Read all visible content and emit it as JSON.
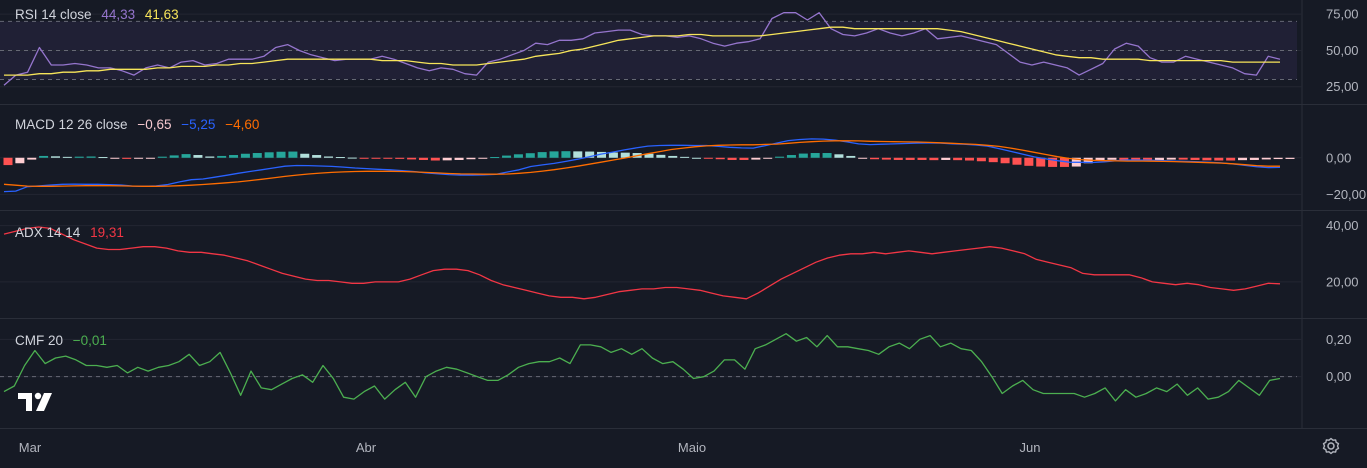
{
  "chart_data": [
    {
      "type": "line",
      "name": "RSI",
      "legend": {
        "title": "RSI 14 close",
        "values": [
          {
            "text": "44,33",
            "color": "#9575cd"
          },
          {
            "text": "41,63",
            "color": "#f7e55a"
          }
        ]
      },
      "ylim": [
        20,
        82
      ],
      "band": [
        30,
        70
      ],
      "ticks": [
        {
          "v": 75,
          "label": "75,00"
        },
        {
          "v": 50,
          "label": "50,00"
        },
        {
          "v": 25,
          "label": "25,00"
        }
      ],
      "dashed": [
        70,
        50,
        30
      ],
      "series": [
        {
          "color": "#9575cd",
          "values": [
            26,
            33,
            35,
            52,
            40,
            40,
            41,
            40,
            38,
            38,
            36,
            33,
            38,
            40,
            38,
            42,
            43,
            40,
            41,
            44,
            44,
            44,
            46,
            52,
            54,
            50,
            47,
            45,
            43,
            44,
            44,
            44,
            46,
            44,
            41,
            38,
            36,
            38,
            37,
            34,
            33,
            42,
            44,
            47,
            50,
            55,
            54,
            57,
            57,
            58,
            62,
            63,
            64,
            64,
            61,
            60,
            60,
            59,
            60,
            58,
            55,
            53,
            55,
            56,
            58,
            72,
            76,
            76,
            71,
            76,
            65,
            61,
            60,
            62,
            65,
            62,
            60,
            62,
            65,
            58,
            59,
            60,
            58,
            56,
            54,
            48,
            42,
            40,
            42,
            40,
            38,
            33,
            37,
            41,
            51,
            55,
            53,
            45,
            42,
            42,
            46,
            44,
            42,
            40,
            38,
            34,
            33,
            46,
            44
          ]
        },
        {
          "color": "#f7e55a",
          "values": [
            33,
            33,
            33,
            34,
            34,
            35,
            35,
            36,
            36,
            37,
            37,
            37,
            37,
            38,
            38,
            39,
            39,
            39,
            40,
            40,
            41,
            41,
            42,
            43,
            44,
            44,
            44,
            44,
            44,
            44,
            44,
            44,
            43,
            43,
            43,
            42,
            41,
            41,
            40,
            40,
            40,
            41,
            42,
            43,
            44,
            46,
            47,
            48,
            50,
            51,
            53,
            55,
            57,
            58,
            59,
            60,
            60,
            60,
            61,
            61,
            60,
            60,
            60,
            60,
            60,
            61,
            62,
            63,
            64,
            65,
            66,
            66,
            65,
            65,
            65,
            65,
            65,
            65,
            65,
            65,
            64,
            63,
            61,
            59,
            57,
            55,
            53,
            51,
            49,
            47,
            46,
            45,
            45,
            44,
            44,
            44,
            44,
            43,
            43,
            43,
            43,
            43,
            43,
            43,
            42,
            42,
            42,
            42,
            42
          ]
        }
      ]
    },
    {
      "type": "bar+line",
      "name": "MACD",
      "legend": {
        "title": "MACD 12 26 close",
        "values": [
          {
            "text": "−0,65",
            "color": "#f6c9d0"
          },
          {
            "text": "−5,25",
            "color": "#2962ff"
          },
          {
            "text": "−4,60",
            "color": "#ff6d00"
          }
        ]
      },
      "ylim": [
        -22,
        13
      ],
      "ticks": [
        {
          "v": 0,
          "label": "0,00"
        },
        {
          "v": -20,
          "label": "−20,00"
        }
      ],
      "histogram": [
        -4,
        -3,
        -1,
        1,
        0.8,
        0.5,
        0.6,
        0.7,
        0.4,
        -0.2,
        -0.6,
        -0.5,
        -0.3,
        0.6,
        1.3,
        2.0,
        1.5,
        0.7,
        1.0,
        1.5,
        2.2,
        2.6,
        3.0,
        3.3,
        3.4,
        2.2,
        1.5,
        0.7,
        0.4,
        0.1,
        -0.1,
        -0.3,
        -0.5,
        -0.6,
        -0.9,
        -1.2,
        -1.5,
        -1.4,
        -1.2,
        -0.8,
        -0.4,
        0.4,
        1.2,
        1.9,
        2.5,
        3.1,
        3.5,
        3.6,
        3.5,
        3.4,
        3.2,
        2.9,
        2.8,
        2.6,
        2.2,
        1.6,
        1.0,
        0.5,
        0,
        -0.4,
        -0.8,
        -1.2,
        -1.2,
        -1.0,
        -0.3,
        0.6,
        1.5,
        2.3,
        2.6,
        2.6,
        1.9,
        1.0,
        -0.2,
        -0.8,
        -1.0,
        -1.2,
        -1.2,
        -1.2,
        -1.3,
        -1.2,
        -1.3,
        -1.5,
        -1.9,
        -2.4,
        -3.0,
        -3.8,
        -4.4,
        -4.8,
        -5.0,
        -5.0,
        -4.8,
        -3.0,
        -1.6,
        -1.1,
        -1.2,
        -1.5,
        -1.5,
        -1.3,
        -1.0,
        -1.0,
        -1.2,
        -1.4,
        -1.5,
        -1.5,
        -1.3,
        -1.2,
        -0.9,
        -0.7,
        -0.65
      ],
      "series": [
        {
          "color": "#2962ff",
          "values": [
            -18.5,
            -18.2,
            -15.8,
            -15.4,
            -14.9,
            -14.5,
            -14.4,
            -14.5,
            -14.5,
            -14.7,
            -14.9,
            -15.5,
            -15.6,
            -15.4,
            -14.6,
            -13.2,
            -12.0,
            -11.6,
            -10.6,
            -9.6,
            -8.5,
            -7.5,
            -6.6,
            -5.6,
            -4.6,
            -4.2,
            -4.3,
            -4.5,
            -4.7,
            -5.1,
            -5.6,
            -5.9,
            -6.3,
            -6.6,
            -7.0,
            -7.5,
            -8.2,
            -8.7,
            -9.2,
            -9.5,
            -9.5,
            -9.3,
            -9.1,
            -7.8,
            -6.6,
            -4.8,
            -3.9,
            -3.1,
            -2.0,
            -0.8,
            0.6,
            2.0,
            3.1,
            4.3,
            5.4,
            6.4,
            6.7,
            6.8,
            6.8,
            6.7,
            6.7,
            6.2,
            5.7,
            5.4,
            5.3,
            6.6,
            8.0,
            9.4,
            10.0,
            10.3,
            10.2,
            9.6,
            8.7,
            7.6,
            7.2,
            7.4,
            7.6,
            7.8,
            8.0,
            8.1,
            8.0,
            7.6,
            7.4,
            7.0,
            6.4,
            5.0,
            3.5,
            2.0,
            0.5,
            -0.6,
            -1.6,
            -2.4,
            -2.5,
            -2.6,
            -2.2,
            -1.6,
            -1.2,
            -1.3,
            -1.4,
            -1.6,
            -1.8,
            -2.0,
            -2.2,
            -2.5,
            -2.8,
            -3.4,
            -4.1,
            -4.9,
            -5.4,
            -5.25
          ]
        },
        {
          "color": "#ff6d00",
          "values": [
            -14.5,
            -15.0,
            -15.5,
            -15.6,
            -15.6,
            -15.5,
            -15.4,
            -15.3,
            -15.3,
            -15.3,
            -15.4,
            -15.5,
            -15.6,
            -15.6,
            -15.5,
            -15.3,
            -15.0,
            -14.6,
            -14.2,
            -13.7,
            -13.2,
            -12.5,
            -11.8,
            -11.0,
            -10.2,
            -9.5,
            -8.9,
            -8.4,
            -8.0,
            -7.7,
            -7.5,
            -7.4,
            -7.4,
            -7.4,
            -7.5,
            -7.7,
            -8.0,
            -8.3,
            -8.6,
            -8.8,
            -8.9,
            -9.0,
            -9.0,
            -8.9,
            -8.5,
            -8.0,
            -7.3,
            -6.5,
            -5.6,
            -4.6,
            -3.5,
            -2.4,
            -1.3,
            -0.2,
            1.0,
            2.2,
            3.4,
            4.5,
            5.3,
            6.0,
            6.5,
            6.8,
            7.0,
            7.1,
            7.1,
            7.3,
            7.5,
            7.9,
            8.4,
            8.8,
            9.1,
            9.3,
            9.3,
            9.2,
            9.0,
            8.9,
            8.8,
            8.7,
            8.6,
            8.4,
            8.2,
            7.9,
            7.6,
            7.3,
            6.8,
            6.2,
            5.3,
            4.2,
            3.0,
            1.8,
            0.6,
            -0.4,
            -1.0,
            -1.4,
            -1.6,
            -1.7,
            -1.8,
            -1.8,
            -1.9,
            -2.0,
            -2.1,
            -2.3,
            -2.5,
            -2.7,
            -2.9,
            -3.3,
            -3.8,
            -4.3,
            -4.6,
            -4.6
          ]
        }
      ]
    },
    {
      "type": "line",
      "name": "ADX",
      "legend": {
        "title": "ADX 14 14",
        "values": [
          {
            "text": "19,31",
            "color": "#f23645"
          }
        ]
      },
      "ylim": [
        10,
        42
      ],
      "ticks": [
        {
          "v": 40,
          "label": "40,00"
        },
        {
          "v": 20,
          "label": "20,00"
        }
      ],
      "series": [
        {
          "color": "#f23645",
          "values": [
            37,
            38,
            39,
            39.5,
            39,
            37,
            35,
            33.5,
            32,
            31.5,
            31.5,
            32,
            32.5,
            32.5,
            32,
            31,
            30.5,
            30.5,
            30,
            29.5,
            28.5,
            27.5,
            26,
            24.5,
            23,
            22,
            21,
            20.5,
            20.5,
            20,
            19.5,
            19.5,
            20,
            20,
            20,
            21,
            22.5,
            24,
            24.5,
            24.5,
            24,
            22.5,
            20.5,
            19,
            18,
            17,
            16,
            15,
            14.5,
            14.5,
            14,
            14.5,
            15.5,
            16.5,
            17,
            17.5,
            17.5,
            18,
            18,
            17.5,
            17,
            16,
            15,
            14.5,
            14,
            16,
            18.5,
            21,
            23,
            25,
            27,
            28.5,
            29.5,
            30,
            30,
            30.5,
            30,
            30.5,
            31,
            30.5,
            30,
            30.5,
            31,
            31.5,
            32,
            32.5,
            32,
            31,
            30,
            28,
            27,
            26,
            25,
            23,
            22.5,
            22.5,
            22.5,
            22.5,
            21.5,
            20,
            19.5,
            19,
            19.5,
            19,
            18,
            17.5,
            17,
            17.5,
            18.5,
            19.5,
            19.3
          ]
        }
      ]
    },
    {
      "type": "line",
      "name": "CMF",
      "legend": {
        "title": "CMF 20",
        "values": [
          {
            "text": "−0,01",
            "color": "#4caf50"
          }
        ]
      },
      "ylim": [
        -0.2,
        0.25
      ],
      "ticks": [
        {
          "v": 0.2,
          "label": "0,20"
        },
        {
          "v": 0,
          "label": "0,00"
        }
      ],
      "dashed": [
        0
      ],
      "series": [
        {
          "color": "#4caf50",
          "values": [
            -0.08,
            -0.05,
            0.06,
            0.14,
            0.07,
            0.1,
            0.11,
            0.09,
            0.06,
            0.06,
            0.05,
            0.06,
            0.02,
            0.05,
            0.03,
            0.05,
            0.06,
            0.08,
            0.12,
            0.06,
            0.08,
            0.13,
            0.02,
            -0.1,
            0.03,
            -0.06,
            -0.07,
            -0.04,
            -0.01,
            0.01,
            -0.03,
            0.06,
            -0.01,
            -0.11,
            -0.12,
            -0.08,
            -0.05,
            -0.12,
            -0.07,
            -0.03,
            -0.11,
            0.0,
            0.03,
            0.05,
            0.04,
            0.02,
            0.0,
            -0.02,
            -0.02,
            0.01,
            0.05,
            0.07,
            0.08,
            0.08,
            0.1,
            0.07,
            0.17,
            0.17,
            0.16,
            0.13,
            0.15,
            0.12,
            0.15,
            0.1,
            0.07,
            0.08,
            0.04,
            -0.01,
            0.0,
            0.03,
            0.09,
            0.09,
            0.04,
            0.15,
            0.17,
            0.2,
            0.23,
            0.19,
            0.21,
            0.16,
            0.22,
            0.16,
            0.16,
            0.15,
            0.14,
            0.12,
            0.16,
            0.18,
            0.15,
            0.2,
            0.22,
            0.16,
            0.18,
            0.15,
            0.14,
            0.08,
            0.0,
            -0.09,
            -0.05,
            -0.02,
            -0.07,
            -0.09,
            -0.09,
            -0.09,
            -0.09,
            -0.11,
            -0.09,
            -0.06,
            -0.13,
            -0.07,
            -0.11,
            -0.09,
            -0.06,
            -0.08,
            -0.04,
            -0.1,
            -0.06,
            -0.12,
            -0.11,
            -0.08,
            -0.02,
            -0.06,
            -0.1,
            -0.02,
            -0.01
          ]
        }
      ]
    }
  ],
  "xaxis": {
    "labels": [
      "Mar",
      "Abr",
      "Maio",
      "Jun"
    ]
  },
  "icons": {
    "logo": "tradingview-logo-icon",
    "settings": "settings-gear-icon"
  }
}
